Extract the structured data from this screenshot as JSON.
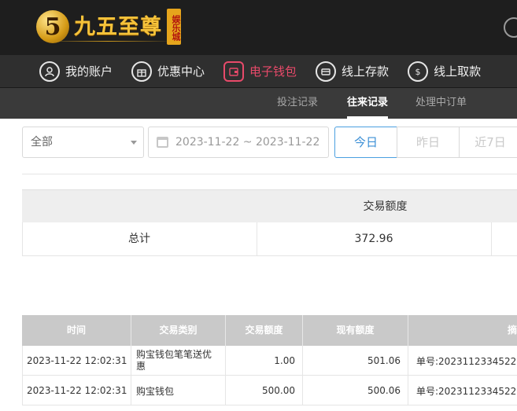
{
  "brand": {
    "logo_mark": "5",
    "name": "九五至尊",
    "seal": "娱乐城"
  },
  "main_nav": [
    {
      "label": "我的账户",
      "icon": "user-icon"
    },
    {
      "label": "优惠中心",
      "icon": "gift-icon"
    },
    {
      "label": "电子钱包",
      "icon": "wallet-icon",
      "active": true
    },
    {
      "label": "线上存款",
      "icon": "deposit-icon"
    },
    {
      "label": "线上取款",
      "icon": "withdraw-icon"
    }
  ],
  "sub_nav": [
    {
      "label": "投注记录"
    },
    {
      "label": "往来记录",
      "active": true
    },
    {
      "label": "处理中订单"
    }
  ],
  "filters": {
    "type_select": "全部",
    "date_range": "2023-11-22 ~ 2023-11-22",
    "quick": [
      "今日",
      "昨日",
      "近7日"
    ]
  },
  "summary": {
    "header": "交易额度",
    "total_label": "总计",
    "total_value": "372.96"
  },
  "detail": {
    "headers": [
      "时间",
      "交易类别",
      "交易额度",
      "现有额度",
      "摘"
    ],
    "rows": [
      {
        "time": "2023-11-22 12:02:31",
        "type": "购宝钱包笔笔送优惠",
        "amount": "1.00",
        "balance": "501.06",
        "memo": "单号:2023112334522"
      },
      {
        "time": "2023-11-22 12:02:31",
        "type": "购宝钱包",
        "amount": "500.00",
        "balance": "500.06",
        "memo": "单号:2023112334522"
      }
    ]
  },
  "colors": {
    "accent": "#e84a6a",
    "gold": "#f5c23a",
    "link_blue": "#3b8fd6"
  }
}
